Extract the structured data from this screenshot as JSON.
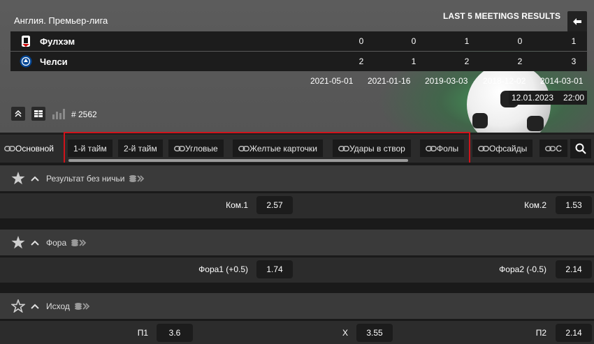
{
  "header": {
    "league": "Англия. Премьер-лига",
    "meetings_title": "LAST 5 MEETINGS RESULTS",
    "teams": [
      {
        "name": "Фулхэм",
        "scores": [
          "0",
          "0",
          "1",
          "0",
          "1"
        ]
      },
      {
        "name": "Челси",
        "scores": [
          "2",
          "1",
          "2",
          "2",
          "3"
        ]
      }
    ],
    "dates": [
      "2021-05-01",
      "2021-01-16",
      "2019-03-03",
      "2018-12-02",
      "2014-03-01"
    ],
    "match_date": "12.01.2023",
    "match_time": "22:00",
    "game_id": "# 2562"
  },
  "tabs": [
    "Основной",
    "1-й тайм",
    "2-й тайм",
    "Угловые",
    "Желтые карточки",
    "Удары в створ",
    "Фолы",
    "Офсайды",
    "С"
  ],
  "markets": [
    {
      "title": "Результат без ничьи",
      "outcomes": [
        {
          "label": "Ком.1",
          "odd": "2.57"
        },
        {
          "label": "Ком.2",
          "odd": "1.53"
        }
      ]
    },
    {
      "title": "Фора",
      "outcomes": [
        {
          "label": "Фора1 (+0.5)",
          "odd": "1.74"
        },
        {
          "label": "Фора2 (-0.5)",
          "odd": "2.14"
        }
      ]
    },
    {
      "title": "Исход",
      "outcomes": [
        {
          "label": "П1",
          "odd": "3.6"
        },
        {
          "label": "X",
          "odd": "3.55"
        },
        {
          "label": "П2",
          "odd": "2.14"
        }
      ]
    }
  ],
  "colors": {
    "highlight": "#d0131b",
    "fulham": "#ffffff",
    "chelsea": "#034694"
  }
}
